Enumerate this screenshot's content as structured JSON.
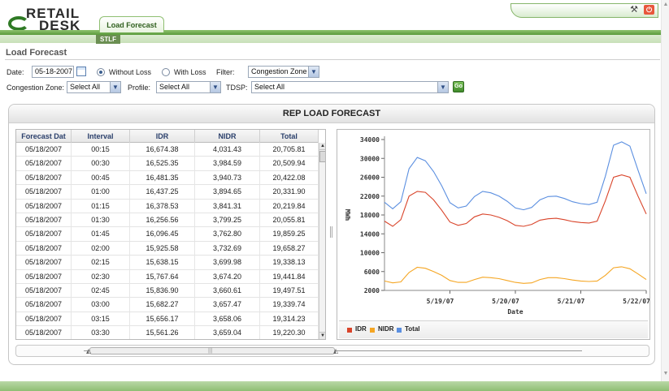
{
  "app": {
    "logo_line1": "RETAIL",
    "logo_line2": "DESK",
    "tab_load_forecast": "Load Forecast",
    "subtab_stlf": "STLF",
    "power_glyph": "⏻"
  },
  "page": {
    "title": "Load Forecast"
  },
  "filters": {
    "date_label": "Date:",
    "date_value": "05-18-2007",
    "without_loss_label": "Without Loss",
    "with_loss_label": "With Loss",
    "loss_selected": "Without Loss",
    "filter_label": "Filter:",
    "filter_value": "Congestion Zone",
    "congestion_zone_label": "Congestion Zone:",
    "congestion_zone_value": "Select All",
    "profile_label": "Profile:",
    "profile_value": "Select All",
    "tdsp_label": "TDSP:",
    "tdsp_value": "Select All",
    "go_label": "Go"
  },
  "panel": {
    "title": "REP LOAD FORECAST"
  },
  "table": {
    "columns": [
      "Forecast Dat",
      "Interval",
      "IDR",
      "NIDR",
      "Total"
    ],
    "rows": [
      [
        "05/18/2007",
        "00:15",
        "16,674.38",
        "4,031.43",
        "20,705.81"
      ],
      [
        "05/18/2007",
        "00:30",
        "16,525.35",
        "3,984.59",
        "20,509.94"
      ],
      [
        "05/18/2007",
        "00:45",
        "16,481.35",
        "3,940.73",
        "20,422.08"
      ],
      [
        "05/18/2007",
        "01:00",
        "16,437.25",
        "3,894.65",
        "20,331.90"
      ],
      [
        "05/18/2007",
        "01:15",
        "16,378.53",
        "3,841.31",
        "20,219.84"
      ],
      [
        "05/18/2007",
        "01:30",
        "16,256.56",
        "3,799.25",
        "20,055.81"
      ],
      [
        "05/18/2007",
        "01:45",
        "16,096.45",
        "3,762.80",
        "19,859.25"
      ],
      [
        "05/18/2007",
        "02:00",
        "15,925.58",
        "3,732.69",
        "19,658.27"
      ],
      [
        "05/18/2007",
        "02:15",
        "15,638.15",
        "3,699.98",
        "19,338.13"
      ],
      [
        "05/18/2007",
        "02:30",
        "15,767.64",
        "3,674.20",
        "19,441.84"
      ],
      [
        "05/18/2007",
        "02:45",
        "15,836.90",
        "3,660.61",
        "19,497.51"
      ],
      [
        "05/18/2007",
        "03:00",
        "15,682.27",
        "3,657.47",
        "19,339.74"
      ],
      [
        "05/18/2007",
        "03:15",
        "15,656.17",
        "3,658.06",
        "19,314.23"
      ],
      [
        "05/18/2007",
        "03:30",
        "15,561.26",
        "3,659.04",
        "19,220.30"
      ]
    ]
  },
  "colors": {
    "idr": "#d9442a",
    "nidr": "#f5a623",
    "total": "#5b8fe0",
    "accent": "#5a9a3c"
  },
  "chart_data": {
    "type": "line",
    "xlabel": "Date",
    "ylabel": "MWh",
    "ylim": [
      2000,
      34000
    ],
    "yticks": [
      2000,
      6000,
      10000,
      14000,
      18000,
      22000,
      26000,
      30000,
      34000
    ],
    "ytick_labels": [
      "2000",
      "6000",
      "10000",
      "14000",
      "18000",
      "22000",
      "26000",
      "30000",
      "34000"
    ],
    "xlim": [
      "5/18/07",
      "5/22/07"
    ],
    "xtick_labels": [
      "5/19/07",
      "5/20/07",
      "5/21/07",
      "5/22/07"
    ],
    "x": [
      "5/18 00:00",
      "5/18 03:00",
      "5/18 06:00",
      "5/18 09:00",
      "5/18 12:00",
      "5/18 15:00",
      "5/18 18:00",
      "5/18 21:00",
      "5/19 00:00",
      "5/19 03:00",
      "5/19 06:00",
      "5/19 09:00",
      "5/19 12:00",
      "5/19 15:00",
      "5/19 18:00",
      "5/19 21:00",
      "5/20 00:00",
      "5/20 03:00",
      "5/20 06:00",
      "5/20 09:00",
      "5/20 12:00",
      "5/20 15:00",
      "5/20 18:00",
      "5/20 21:00",
      "5/21 00:00",
      "5/21 03:00",
      "5/21 06:00",
      "5/21 09:00",
      "5/21 12:00",
      "5/21 15:00",
      "5/21 18:00",
      "5/21 21:00",
      "5/22 00:00"
    ],
    "series": [
      {
        "name": "IDR",
        "values": [
          16700,
          15600,
          17000,
          22000,
          23000,
          22800,
          21200,
          19000,
          16500,
          15800,
          16200,
          17600,
          18200,
          18000,
          17500,
          16800,
          15800,
          15600,
          16000,
          16900,
          17200,
          17300,
          17000,
          16600,
          16400,
          16300,
          16700,
          21000,
          26000,
          26500,
          26000,
          22000,
          18200
        ]
      },
      {
        "name": "NIDR",
        "values": [
          4000,
          3600,
          3800,
          5800,
          6900,
          6700,
          6000,
          5200,
          4100,
          3700,
          3700,
          4300,
          4800,
          4700,
          4500,
          4100,
          3700,
          3500,
          3600,
          4300,
          4700,
          4700,
          4500,
          4200,
          4000,
          3900,
          4000,
          5200,
          6800,
          7000,
          6600,
          5500,
          4300
        ]
      },
      {
        "name": "Total",
        "values": [
          20700,
          19300,
          20800,
          27800,
          30200,
          29500,
          27200,
          24200,
          20600,
          19500,
          19900,
          21900,
          23000,
          22700,
          22000,
          20900,
          19500,
          19100,
          19600,
          21200,
          21900,
          22000,
          21500,
          20800,
          20400,
          20200,
          20700,
          26200,
          32800,
          33500,
          32600,
          27500,
          22500
        ]
      }
    ]
  }
}
